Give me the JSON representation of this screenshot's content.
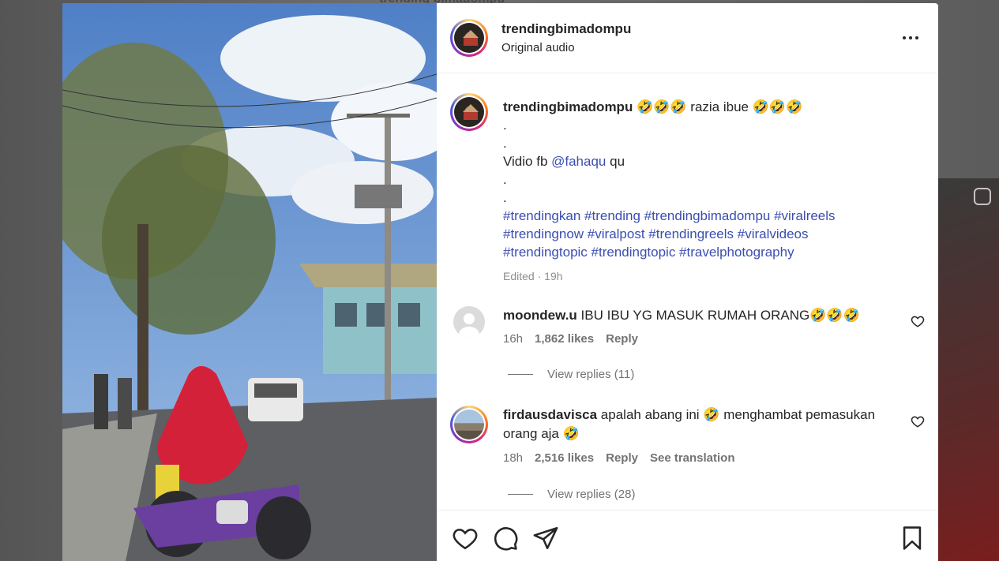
{
  "background": {
    "peek_text": "trending bimadompu"
  },
  "header": {
    "username": "trendingbimadompu",
    "audio": "Original audio",
    "more_icon": "more-horizontal-icon"
  },
  "caption": {
    "username": "trendingbimadompu",
    "line1": "🤣🤣🤣 razia ibue 🤣🤣🤣",
    "dot1": ".",
    "dot2": ".",
    "vidio_prefix": "Vidio fb ",
    "mention": "@fahaqu",
    "vidio_suffix": " qu",
    "dot3": ".",
    "dot4": ".",
    "hashtags_1": "#trendingkan #trending #trendingbimadompu #viralreels",
    "hashtags_2": "#trendingnow #viralpost #trendingreels #viralvideos",
    "hashtags_3": "#trendingtopic #trendingtopic #travelphotography",
    "edited": "Edited",
    "separator": "·",
    "time": "19h"
  },
  "comments": [
    {
      "username": "moondew.u",
      "text": "IBU IBU YG MASUK RUMAH ORANG🤣🤣🤣",
      "time": "16h",
      "likes": "1,862 likes",
      "reply": "Reply",
      "view_replies": "View replies (11)"
    },
    {
      "username": "firdausdavisca",
      "text": "apalah abang ini 🤣 menghambat pemasukan orang aja 🤣",
      "time": "18h",
      "likes": "2,516 likes",
      "reply": "Reply",
      "translate": "See translation",
      "view_replies": "View replies (28)"
    }
  ],
  "actions": {
    "like_icon": "heart-icon",
    "comment_icon": "comment-icon",
    "share_icon": "send-icon",
    "save_icon": "bookmark-icon"
  },
  "colors": {
    "link": "#3b4eb0",
    "text": "#262626",
    "muted": "#737373"
  }
}
